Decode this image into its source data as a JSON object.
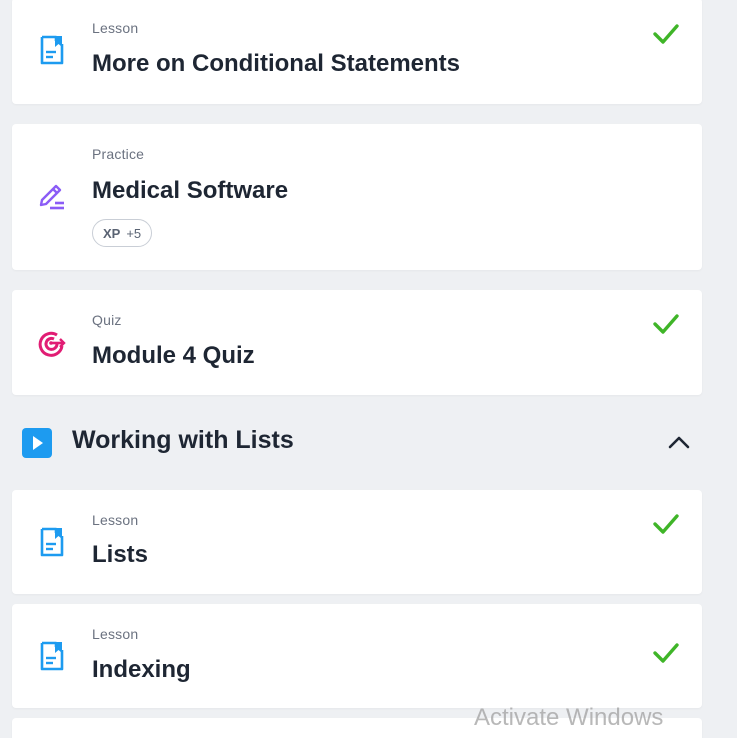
{
  "items_top": [
    {
      "type": "Lesson",
      "title": "More on Conditional Statements",
      "icon": "lesson-icon",
      "completed": true
    },
    {
      "type": "Practice",
      "title": "Medical Software",
      "icon": "pencil-icon",
      "completed": false,
      "badge": {
        "label": "XP",
        "value": "+5"
      }
    },
    {
      "type": "Quiz",
      "title": "Module 4 Quiz",
      "icon": "target-icon",
      "completed": true
    }
  ],
  "section": {
    "title": "Working with Lists",
    "icon": "play-icon",
    "expanded": true
  },
  "items_section": [
    {
      "type": "Lesson",
      "title": "Lists",
      "icon": "lesson-icon",
      "completed": true
    },
    {
      "type": "Lesson",
      "title": "Indexing",
      "icon": "lesson-icon",
      "completed": true
    }
  ],
  "watermark": "Activate Windows",
  "colors": {
    "background": "#eef0f3",
    "card": "#ffffff",
    "lesson_icon": "#1d9bf0",
    "practice_icon": "#8b5cf6",
    "quiz_icon": "#e11d74",
    "check": "#3fb528",
    "title_text": "#1e2633"
  }
}
